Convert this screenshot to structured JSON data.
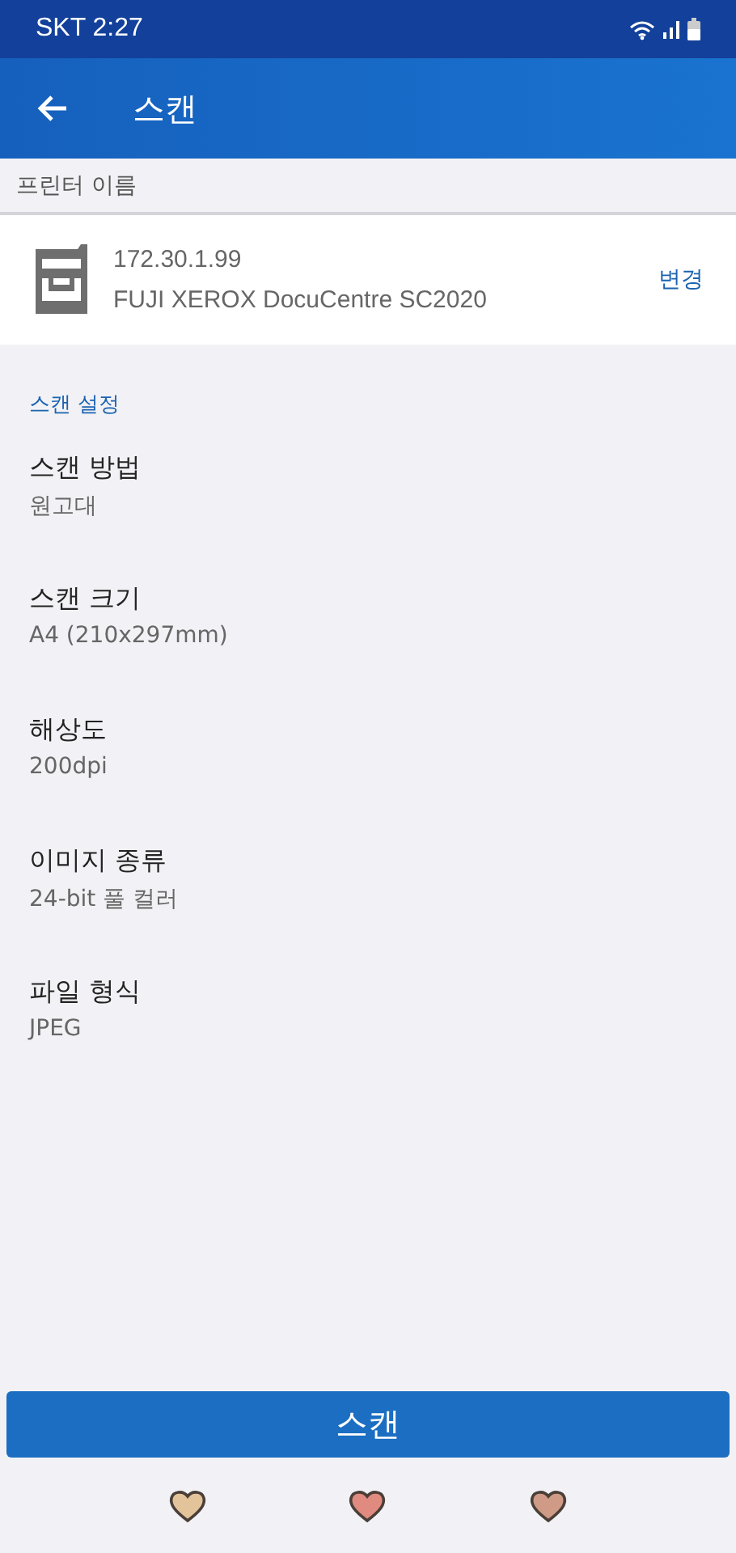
{
  "status_bar": {
    "carrier_time": "SKT 2:27"
  },
  "app_bar": {
    "title": "스캔"
  },
  "printer_section": {
    "header": "프린터 이름",
    "address": "172.30.1.99",
    "model": "FUJI XEROX DocuCentre SC2020",
    "change": "변경"
  },
  "settings": {
    "header": "스캔 설정",
    "items": [
      {
        "label": "스캔 방법",
        "value": "원고대"
      },
      {
        "label": "스캔 크기",
        "value": "A4 (210x297mm)"
      },
      {
        "label": "해상도",
        "value": "200dpi"
      },
      {
        "label": "이미지 종류",
        "value": "24-bit 풀 컬러"
      },
      {
        "label": "파일 형식",
        "value": "JPEG"
      }
    ]
  },
  "scan_button": "스캔",
  "nav_bar": [
    {
      "color": "#e3c39a"
    },
    {
      "color": "#e08a80"
    },
    {
      "color": "#cf9a86"
    }
  ]
}
